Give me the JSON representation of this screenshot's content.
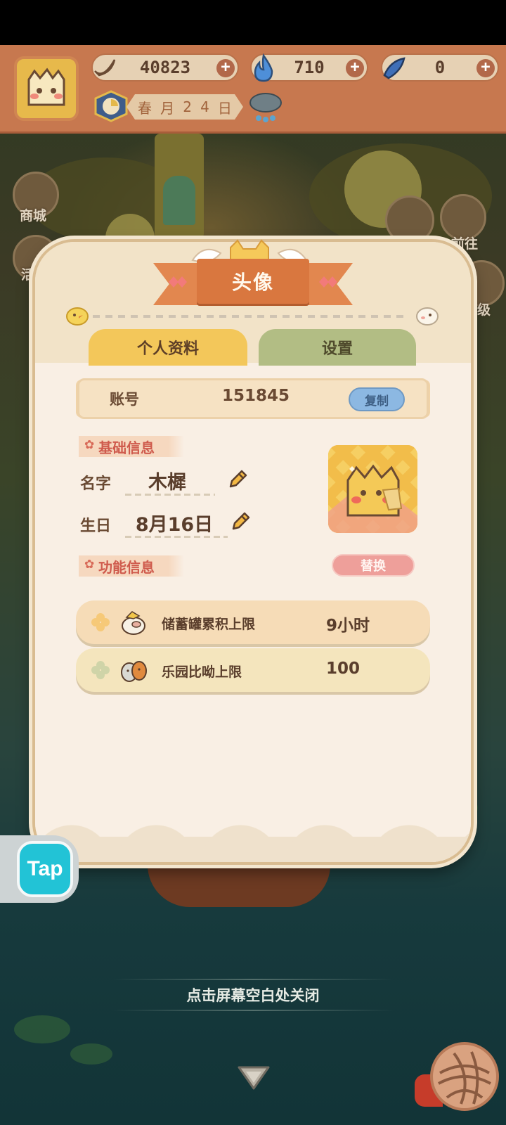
{
  "hud": {
    "bananas": "40823",
    "flames": "710",
    "fish": "0",
    "date": [
      "春",
      "月",
      "2",
      "4",
      "日"
    ]
  },
  "side_buttons": {
    "shop": "商城",
    "event": "活",
    "goto": "前往",
    "level": "等级"
  },
  "dialog": {
    "title": "头像",
    "tabs": {
      "profile": "个人资料",
      "settings": "设置"
    },
    "account": {
      "label": "账号",
      "value": "151845",
      "copy": "复制"
    },
    "basic_section": "基础信息",
    "name": {
      "label": "名字",
      "value": "木樨"
    },
    "birthday": {
      "label": "生日",
      "value": "8月16日"
    },
    "swap_button": "替换",
    "feature_section": "功能信息",
    "features": [
      {
        "name": "储蓄罐累积上限",
        "value": "9小时",
        "icon": "piggy-bank-icon"
      },
      {
        "name": "乐园比呦上限",
        "value": "100",
        "icon": "pets-icon"
      }
    ]
  },
  "tap": {
    "label": "Tap"
  },
  "close_hint": "点击屏幕空白处关闭",
  "colors": {
    "hud": "#c7784f",
    "tab_profile": "#f3c75a",
    "tab_settings": "#b2bd84",
    "title_banner": "#d9773f",
    "section_tag": "#cf5b4d",
    "tap_accent": "#22c3d6"
  }
}
